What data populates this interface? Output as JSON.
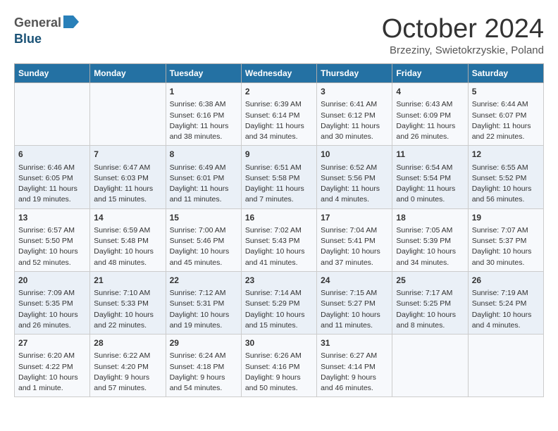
{
  "logo": {
    "general": "General",
    "blue": "Blue"
  },
  "title": "October 2024",
  "location": "Brzeziny, Swietokrzyskie, Poland",
  "days": [
    "Sunday",
    "Monday",
    "Tuesday",
    "Wednesday",
    "Thursday",
    "Friday",
    "Saturday"
  ],
  "weeks": [
    [
      {
        "day": "",
        "data": ""
      },
      {
        "day": "",
        "data": ""
      },
      {
        "day": "1",
        "data": "Sunrise: 6:38 AM\nSunset: 6:16 PM\nDaylight: 11 hours and 38 minutes."
      },
      {
        "day": "2",
        "data": "Sunrise: 6:39 AM\nSunset: 6:14 PM\nDaylight: 11 hours and 34 minutes."
      },
      {
        "day": "3",
        "data": "Sunrise: 6:41 AM\nSunset: 6:12 PM\nDaylight: 11 hours and 30 minutes."
      },
      {
        "day": "4",
        "data": "Sunrise: 6:43 AM\nSunset: 6:09 PM\nDaylight: 11 hours and 26 minutes."
      },
      {
        "day": "5",
        "data": "Sunrise: 6:44 AM\nSunset: 6:07 PM\nDaylight: 11 hours and 22 minutes."
      }
    ],
    [
      {
        "day": "6",
        "data": "Sunrise: 6:46 AM\nSunset: 6:05 PM\nDaylight: 11 hours and 19 minutes."
      },
      {
        "day": "7",
        "data": "Sunrise: 6:47 AM\nSunset: 6:03 PM\nDaylight: 11 hours and 15 minutes."
      },
      {
        "day": "8",
        "data": "Sunrise: 6:49 AM\nSunset: 6:01 PM\nDaylight: 11 hours and 11 minutes."
      },
      {
        "day": "9",
        "data": "Sunrise: 6:51 AM\nSunset: 5:58 PM\nDaylight: 11 hours and 7 minutes."
      },
      {
        "day": "10",
        "data": "Sunrise: 6:52 AM\nSunset: 5:56 PM\nDaylight: 11 hours and 4 minutes."
      },
      {
        "day": "11",
        "data": "Sunrise: 6:54 AM\nSunset: 5:54 PM\nDaylight: 11 hours and 0 minutes."
      },
      {
        "day": "12",
        "data": "Sunrise: 6:55 AM\nSunset: 5:52 PM\nDaylight: 10 hours and 56 minutes."
      }
    ],
    [
      {
        "day": "13",
        "data": "Sunrise: 6:57 AM\nSunset: 5:50 PM\nDaylight: 10 hours and 52 minutes."
      },
      {
        "day": "14",
        "data": "Sunrise: 6:59 AM\nSunset: 5:48 PM\nDaylight: 10 hours and 48 minutes."
      },
      {
        "day": "15",
        "data": "Sunrise: 7:00 AM\nSunset: 5:46 PM\nDaylight: 10 hours and 45 minutes."
      },
      {
        "day": "16",
        "data": "Sunrise: 7:02 AM\nSunset: 5:43 PM\nDaylight: 10 hours and 41 minutes."
      },
      {
        "day": "17",
        "data": "Sunrise: 7:04 AM\nSunset: 5:41 PM\nDaylight: 10 hours and 37 minutes."
      },
      {
        "day": "18",
        "data": "Sunrise: 7:05 AM\nSunset: 5:39 PM\nDaylight: 10 hours and 34 minutes."
      },
      {
        "day": "19",
        "data": "Sunrise: 7:07 AM\nSunset: 5:37 PM\nDaylight: 10 hours and 30 minutes."
      }
    ],
    [
      {
        "day": "20",
        "data": "Sunrise: 7:09 AM\nSunset: 5:35 PM\nDaylight: 10 hours and 26 minutes."
      },
      {
        "day": "21",
        "data": "Sunrise: 7:10 AM\nSunset: 5:33 PM\nDaylight: 10 hours and 22 minutes."
      },
      {
        "day": "22",
        "data": "Sunrise: 7:12 AM\nSunset: 5:31 PM\nDaylight: 10 hours and 19 minutes."
      },
      {
        "day": "23",
        "data": "Sunrise: 7:14 AM\nSunset: 5:29 PM\nDaylight: 10 hours and 15 minutes."
      },
      {
        "day": "24",
        "data": "Sunrise: 7:15 AM\nSunset: 5:27 PM\nDaylight: 10 hours and 11 minutes."
      },
      {
        "day": "25",
        "data": "Sunrise: 7:17 AM\nSunset: 5:25 PM\nDaylight: 10 hours and 8 minutes."
      },
      {
        "day": "26",
        "data": "Sunrise: 7:19 AM\nSunset: 5:24 PM\nDaylight: 10 hours and 4 minutes."
      }
    ],
    [
      {
        "day": "27",
        "data": "Sunrise: 6:20 AM\nSunset: 4:22 PM\nDaylight: 10 hours and 1 minute."
      },
      {
        "day": "28",
        "data": "Sunrise: 6:22 AM\nSunset: 4:20 PM\nDaylight: 9 hours and 57 minutes."
      },
      {
        "day": "29",
        "data": "Sunrise: 6:24 AM\nSunset: 4:18 PM\nDaylight: 9 hours and 54 minutes."
      },
      {
        "day": "30",
        "data": "Sunrise: 6:26 AM\nSunset: 4:16 PM\nDaylight: 9 hours and 50 minutes."
      },
      {
        "day": "31",
        "data": "Sunrise: 6:27 AM\nSunset: 4:14 PM\nDaylight: 9 hours and 46 minutes."
      },
      {
        "day": "",
        "data": ""
      },
      {
        "day": "",
        "data": ""
      }
    ]
  ]
}
